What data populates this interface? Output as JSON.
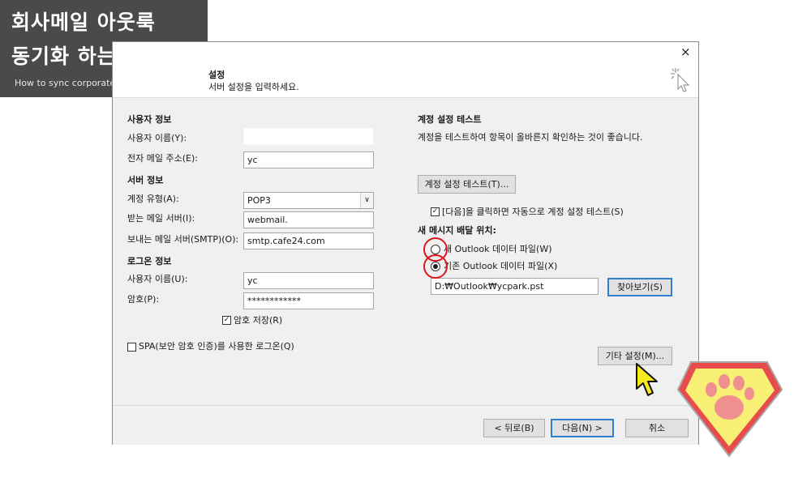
{
  "banner": {
    "line1": "회사메일 아웃룩",
    "line2": "동기화 하는 방법",
    "subtitle": "How to sync corporate mail to Outlook"
  },
  "dialog": {
    "header_title": "설정",
    "header_subtitle": "서버 설정을 입력하세요.",
    "close_label": "×",
    "user_info": {
      "heading": "사용자 정보",
      "name_label": "사용자 이름(Y):",
      "name_value": "",
      "email_label": "전자 메일 주소(E):",
      "email_value": "yc"
    },
    "server_info": {
      "heading": "서버 정보",
      "account_type_label": "계정 유형(A):",
      "account_type_value": "POP3",
      "incoming_label": "받는 메일 서버(I):",
      "incoming_value": "webmail.",
      "outgoing_label": "보내는 메일 서버(SMTP)(O):",
      "outgoing_value": "smtp.cafe24.com"
    },
    "logon_info": {
      "heading": "로그온 정보",
      "user_label": "사용자 이름(U):",
      "user_value": "yc",
      "password_label": "암호(P):",
      "password_value": "************",
      "remember_password_label": "암호 저장(R)",
      "spa_label": "SPA(보안 암호 인증)를 사용한 로그온(Q)"
    },
    "test": {
      "heading": "계정 설정 테스트",
      "description": "계정을 테스트하여 항목이 올바른지 확인하는 것이 좋습니다.",
      "test_button": "계정 설정 테스트(T)...",
      "auto_test_label": "[다음]을 클릭하면 자동으로 계정 설정 테스트(S)"
    },
    "delivery": {
      "heading": "새 메시지 배달 위치:",
      "new_file_label": "새 Outlook 데이터 파일(W)",
      "existing_file_label": "기존 Outlook 데이터 파일(X)",
      "path_value": "D:₩Outlook₩ycpark.pst",
      "browse_button": "찾아보기(S)"
    },
    "more_settings_button": "기타 설정(M)...",
    "footer": {
      "back_button": "< 뒤로(B)",
      "next_button": "다음(N) >",
      "cancel_button": "취소"
    }
  },
  "colors": {
    "banner_bg": "#4a4a4a",
    "highlight_circle": "#d9181e",
    "cursor_yellow": "#f7ea1c",
    "badge_red": "#e84b4b",
    "badge_yellow": "#f7f074",
    "badge_paw": "#ef8f8f"
  }
}
